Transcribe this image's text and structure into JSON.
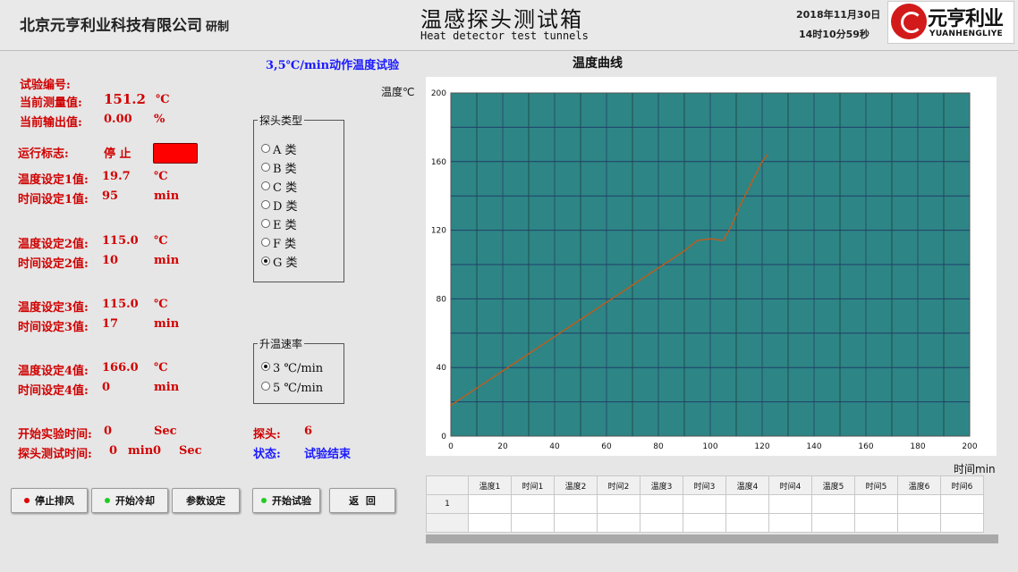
{
  "header": {
    "company": "北京元亨利业科技有限公司",
    "company_suffix": "研制",
    "title_cn": "温感探头测试箱",
    "title_en": "Heat detector test tunnels",
    "date": "2018年11月30日",
    "time": "14时10分59秒",
    "logo_text": "元亨利业",
    "logo_en": "YUANHENGLIYE"
  },
  "test_mode": "3,5℃/min动作温度试验",
  "left": {
    "test_no_label": "试验编号:",
    "cur_meas_label": "当前测量值:",
    "cur_meas_value": "151.2",
    "cur_meas_unit": "℃",
    "cur_out_label": "当前输出值:",
    "cur_out_value": "0.00",
    "cur_out_unit": "%",
    "run_label": "运行标志:",
    "run_value": "停 止",
    "settings": [
      {
        "t_label": "温度设定1值:",
        "t_value": "19.7",
        "t_unit": "℃",
        "m_label": "时间设定1值:",
        "m_value": "95",
        "m_unit": "min"
      },
      {
        "t_label": "温度设定2值:",
        "t_value": "115.0",
        "t_unit": "℃",
        "m_label": "时间设定2值:",
        "m_value": "10",
        "m_unit": "min"
      },
      {
        "t_label": "温度设定3值:",
        "t_value": "115.0",
        "t_unit": "℃",
        "m_label": "时间设定3值:",
        "m_value": "17",
        "m_unit": "min"
      },
      {
        "t_label": "温度设定4值:",
        "t_value": "166.0",
        "t_unit": "℃",
        "m_label": "时间设定4值:",
        "m_value": "0",
        "m_unit": "min"
      }
    ],
    "start_time_label": "开始实验时间:",
    "start_time_value": "0",
    "start_time_unit": "Sec",
    "probe_time_label": "探头测试时间:",
    "probe_time_min": "0",
    "probe_time_min_unit": "min",
    "probe_time_sec": "0",
    "probe_time_sec_unit": "Sec",
    "probe_label": "探头:",
    "probe_value": "6",
    "status_label": "状态:",
    "status_value": "试验结束"
  },
  "probe_type": {
    "title": "探头类型",
    "options": [
      "A 类",
      "B 类",
      "C 类",
      "D 类",
      "E 类",
      "F 类",
      "G 类"
    ],
    "selected": "G 类"
  },
  "rate": {
    "title": "升温速率",
    "options": [
      "3 ℃/min",
      "5 ℃/min"
    ],
    "selected": "3 ℃/min"
  },
  "buttons": {
    "stop_exhaust": "停止排风",
    "start_cooling": "开始冷却",
    "params": "参数设定",
    "start_test": "开始试验",
    "back": "返  回"
  },
  "colors": {
    "plot_bg": "#2e8585",
    "curve": "#c85a14",
    "indicator_red": "#ff0000",
    "dot_red": "#e00000",
    "dot_green": "#22cc22"
  },
  "chart_data": {
    "type": "line",
    "title": "温度曲线",
    "xlabel": "时间min",
    "ylabel": "温度℃",
    "xlim": [
      0,
      200
    ],
    "ylim": [
      0,
      200
    ],
    "xticks": [
      0,
      20,
      40,
      60,
      80,
      100,
      120,
      140,
      160,
      180,
      200
    ],
    "yticks": [
      0,
      40,
      80,
      120,
      160,
      200
    ],
    "grid": true,
    "series": [
      {
        "x": [
          0,
          10,
          20,
          30,
          40,
          50,
          60,
          70,
          80,
          90,
          95,
          100,
          105,
          108,
          112,
          116,
          120,
          122
        ],
        "y": [
          18,
          28,
          38,
          48,
          58,
          68,
          78,
          88,
          98,
          108,
          114,
          115,
          114,
          122,
          136,
          148,
          160,
          164
        ]
      }
    ]
  },
  "table": {
    "headers": [
      "温度1",
      "时间1",
      "温度2",
      "时间2",
      "温度3",
      "时间3",
      "温度4",
      "时间4",
      "温度5",
      "时间5",
      "温度6",
      "时间6"
    ],
    "rows": [
      {
        "index": "1",
        "cells": [
          "",
          "",
          "",
          "",
          "",
          "",
          "",
          "",
          "",
          "",
          "",
          ""
        ]
      },
      {
        "index": "",
        "cells": [
          "",
          "",
          "",
          "",
          "",
          "",
          "",
          "",
          "",
          "",
          "",
          ""
        ]
      }
    ]
  }
}
